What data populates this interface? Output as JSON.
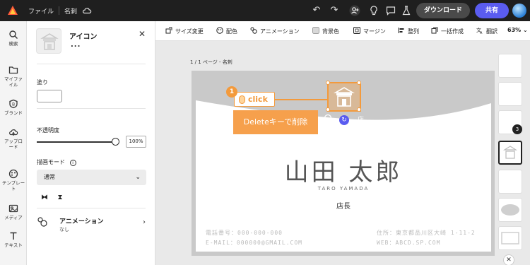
{
  "topbar": {
    "file_menu": "ファイル",
    "doc_name": "名刺",
    "download_label": "ダウンロード",
    "share_label": "共有"
  },
  "rail": {
    "items": [
      {
        "label": "検索",
        "icon": "search-icon"
      },
      {
        "label": "マイファイル",
        "icon": "folder-icon"
      },
      {
        "label": "ブランド",
        "icon": "brand-icon"
      },
      {
        "label": "アップロード",
        "icon": "upload-icon"
      },
      {
        "label": "テンプレート",
        "icon": "template-icon"
      },
      {
        "label": "メディア",
        "icon": "media-icon"
      },
      {
        "label": "テキスト",
        "icon": "text-icon"
      }
    ]
  },
  "panel": {
    "title": "アイコン",
    "more": "...",
    "fill_label": "塗り",
    "opacity_label": "不透明度",
    "opacity_value": "100%",
    "opacity_level": 1.0,
    "blend_label": "描画モード",
    "blend_value": "通常",
    "animation_title": "アニメーション",
    "animation_value": "なし"
  },
  "toolbar": {
    "items": [
      {
        "label": "サイズ変更",
        "icon": "resize-icon"
      },
      {
        "label": "配色",
        "icon": "palette-icon"
      },
      {
        "label": "アニメーション",
        "icon": "animation-icon"
      },
      {
        "label": "背景色",
        "icon": "bg-color-icon"
      },
      {
        "label": "マージン",
        "icon": "margin-icon"
      },
      {
        "label": "整列",
        "icon": "align-icon"
      },
      {
        "label": "一括作成",
        "icon": "bulk-create-icon"
      },
      {
        "label": "翻訳",
        "icon": "translate-icon"
      }
    ],
    "zoom": "63%"
  },
  "canvas": {
    "page_label": "1 / 1 ページ - 名刺",
    "card": {
      "name": "山田 太郎",
      "name_roman": "TARO YAMADA",
      "role": "店長",
      "phone": "電話番号：000-000-000",
      "email": "E-MAIL：000000@GMAIL.COM",
      "address": "住所：東京都品川区大崎 1-11-2",
      "web": "WEB：ABCD.SP.COM",
      "shop_fragment": "店"
    }
  },
  "tutorial": {
    "step": "1",
    "click_label": "click",
    "instruction": "Deleteキーで削除"
  },
  "thumbs": {
    "badge": "3"
  },
  "colors": {
    "accent": "#5a5cf0",
    "highlight": "#f39a3c",
    "topbar": "#1f1f1f"
  }
}
